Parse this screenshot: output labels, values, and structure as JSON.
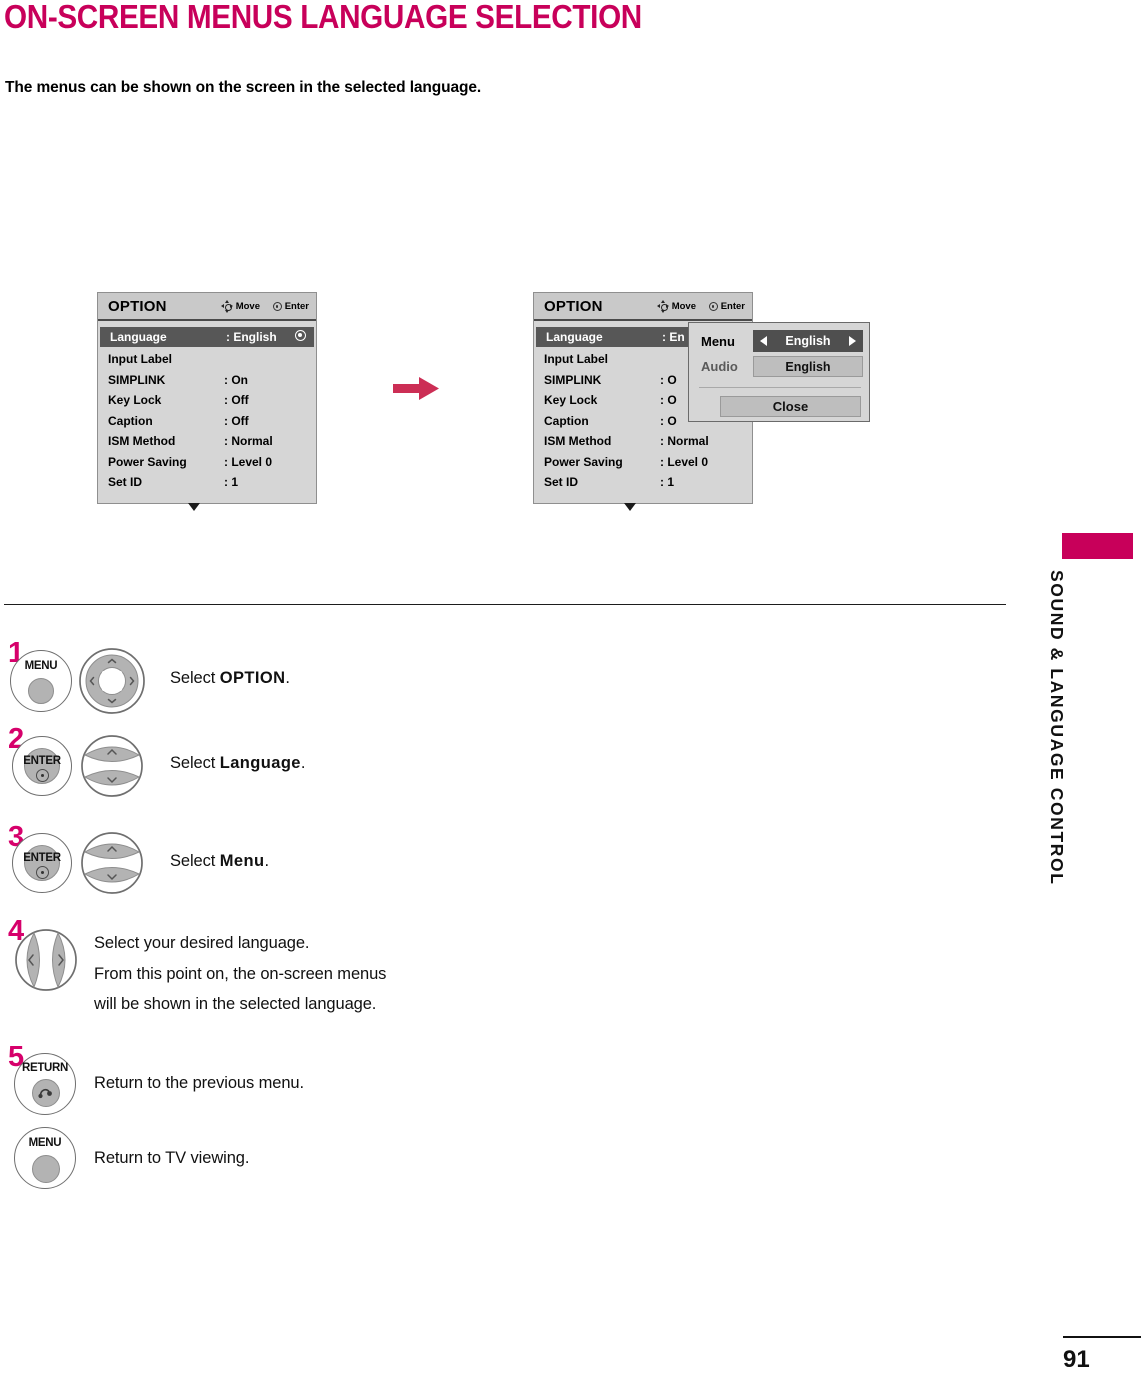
{
  "page": {
    "title": "ON-SCREEN MENUS LANGUAGE SELECTION",
    "intro": "The menus can be shown on the screen in the selected language.",
    "number": "91",
    "accent_color": "#c8005a",
    "step_number_color": "#d6006b"
  },
  "rail": {
    "label": "SOUND & LANGUAGE CONTROL"
  },
  "osd": {
    "header": {
      "title": "OPTION",
      "move_label": "Move",
      "enter_label": "Enter"
    },
    "rows": [
      {
        "label": "Language",
        "value": ": English"
      },
      {
        "label": "Input Label",
        "value": ""
      },
      {
        "label": "SIMPLINK",
        "value": ": On"
      },
      {
        "label": "Key Lock",
        "value": ": Off"
      },
      {
        "label": "Caption",
        "value": ": Off"
      },
      {
        "label": "ISM Method",
        "value": ": Normal"
      },
      {
        "label": "Power Saving",
        "value": ": Level 0"
      },
      {
        "label": "Set ID",
        "value": ": 1"
      }
    ],
    "rows_clipped": [
      {
        "label": "Language",
        "value": ": En"
      },
      {
        "label": "Input Label",
        "value": ""
      },
      {
        "label": "SIMPLINK",
        "value": ": O"
      },
      {
        "label": "Key Lock",
        "value": ": O"
      },
      {
        "label": "Caption",
        "value": ": O"
      },
      {
        "label": "ISM Method",
        "value": ": Normal"
      },
      {
        "label": "Power Saving",
        "value": ": Level 0"
      },
      {
        "label": "Set ID",
        "value": ": 1"
      }
    ]
  },
  "popup": {
    "menu_label": "Menu",
    "menu_value": "English",
    "audio_label": "Audio",
    "audio_value": "English",
    "close_label": "Close"
  },
  "steps": [
    {
      "number": "1",
      "button_label": "MENU",
      "lines": [
        "Select OPTION."
      ],
      "bold_part": "OPTION"
    },
    {
      "number": "2",
      "button_label": "ENTER",
      "lines": [
        "Select Language."
      ],
      "bold_part": "Language"
    },
    {
      "number": "3",
      "button_label": "ENTER",
      "lines": [
        "Select Menu."
      ],
      "bold_part": "Menu"
    },
    {
      "number": "4",
      "button_label": "",
      "lines": [
        "Select your desired language.",
        "From this point on, the on-screen menus",
        "will be shown in the selected language."
      ],
      "bold_part": ""
    },
    {
      "number": "5",
      "button_label": "RETURN",
      "lines": [
        "Return to the previous menu."
      ],
      "bold_part": ""
    },
    {
      "number": "",
      "button_label": "MENU",
      "lines": [
        "Return to TV viewing."
      ],
      "bold_part": ""
    }
  ],
  "step_text": {
    "s1_prefix": "Select ",
    "s1_bold": "OPTION",
    "s1_suffix": ".",
    "s2_prefix": "Select ",
    "s2_bold": "Language",
    "s2_suffix": ".",
    "s3_prefix": "Select ",
    "s3_bold": "Menu",
    "s3_suffix": ".",
    "s4_l1": "Select your desired language.",
    "s4_l2": "From this point on, the on-screen menus",
    "s4_l3": "will be shown in the selected language.",
    "s5_l1": "Return to the previous menu.",
    "s6_l1": "Return to TV viewing."
  }
}
